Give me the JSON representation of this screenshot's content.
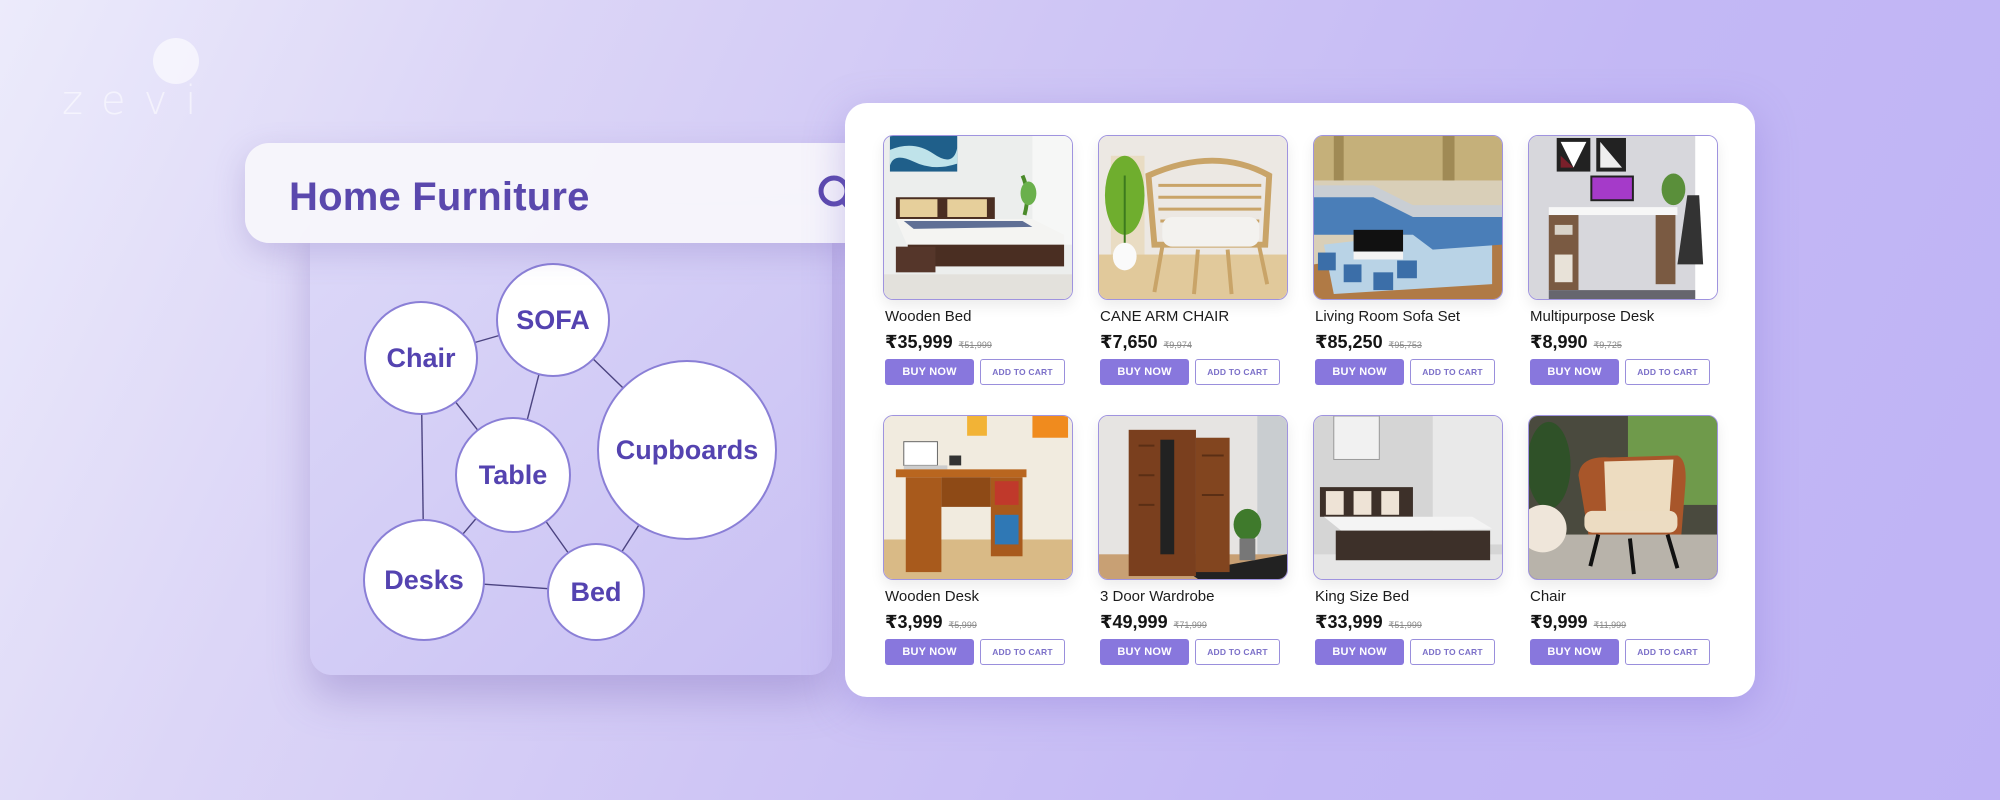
{
  "brand": {
    "logo_text": "zevi"
  },
  "search": {
    "query": "Home Furniture",
    "icon": "search-icon"
  },
  "category_graph": {
    "nodes": [
      {
        "id": "chair",
        "label": "Chair"
      },
      {
        "id": "sofa",
        "label": "SOFA"
      },
      {
        "id": "table",
        "label": "Table"
      },
      {
        "id": "cupboards",
        "label": "Cupboards"
      },
      {
        "id": "desks",
        "label": "Desks"
      },
      {
        "id": "bed",
        "label": "Bed"
      }
    ],
    "edges": [
      [
        "chair",
        "sofa"
      ],
      [
        "chair",
        "table"
      ],
      [
        "chair",
        "desks"
      ],
      [
        "sofa",
        "table"
      ],
      [
        "sofa",
        "cupboards"
      ],
      [
        "table",
        "desks"
      ],
      [
        "table",
        "bed"
      ],
      [
        "desks",
        "bed"
      ],
      [
        "cupboards",
        "bed"
      ]
    ]
  },
  "products": [
    {
      "title": "Wooden Bed",
      "price": "₹35,999",
      "mrp": "₹51,999",
      "buy_label": "BUY NOW",
      "cart_label": "ADD TO CART",
      "image": "wooden-bed-image"
    },
    {
      "title": "CANE ARM CHAIR",
      "price": "₹7,650",
      "mrp": "₹9,974",
      "buy_label": "BUY NOW",
      "cart_label": "ADD TO CART",
      "image": "cane-arm-chair-image"
    },
    {
      "title": "Living Room Sofa Set",
      "price": "₹85,250",
      "mrp": "₹95,753",
      "buy_label": "BUY NOW",
      "cart_label": "ADD TO CART",
      "image": "sofa-set-image"
    },
    {
      "title": "Multipurpose Desk",
      "price": "₹8,990",
      "mrp": "₹9,725",
      "buy_label": "BUY NOW",
      "cart_label": "ADD TO CART",
      "image": "multipurpose-desk-image"
    },
    {
      "title": "Wooden Desk",
      "price": "₹3,999",
      "mrp": "₹5,999",
      "buy_label": "BUY NOW",
      "cart_label": "ADD TO CART",
      "image": "wooden-desk-image"
    },
    {
      "title": "3 Door Wardrobe",
      "price": "₹49,999",
      "mrp": "₹71,999",
      "buy_label": "BUY NOW",
      "cart_label": "ADD TO CART",
      "image": "wardrobe-image"
    },
    {
      "title": "King Size Bed",
      "price": "₹33,999",
      "mrp": "₹51,999",
      "buy_label": "BUY NOW",
      "cart_label": "ADD TO CART",
      "image": "king-size-bed-image"
    },
    {
      "title": "Chair",
      "price": "₹9,999",
      "mrp": "₹11,999",
      "buy_label": "BUY NOW",
      "cart_label": "ADD TO CART",
      "image": "lounge-chair-image"
    }
  ],
  "colors": {
    "accent": "#8877dd",
    "accent_dark": "#5a48ad",
    "bubble_stroke": "#8a7fd6",
    "background_light": "#ecebfb",
    "background_dark": "#bfb3f5"
  }
}
